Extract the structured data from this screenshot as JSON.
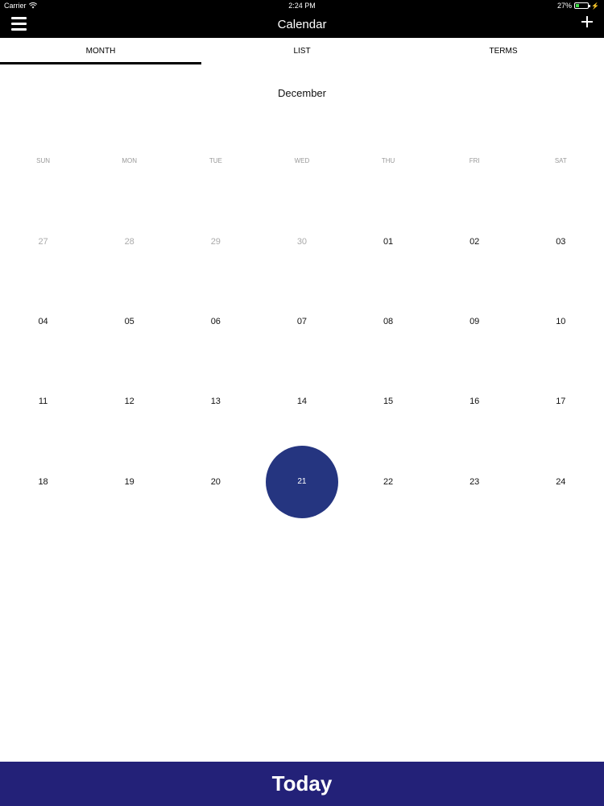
{
  "status_bar": {
    "carrier": "Carrier",
    "time": "2:24 PM",
    "battery": "27%",
    "battery_level": 0.27,
    "icons": [
      "wifi-icon",
      "battery-icon",
      "charge-icon"
    ]
  },
  "nav": {
    "title": "Calendar",
    "menu_icon": "menu-icon",
    "add_icon": "add-icon"
  },
  "tabs": [
    {
      "label": "MONTH",
      "active": true
    },
    {
      "label": "LIST",
      "active": false
    },
    {
      "label": "TERMS",
      "active": false
    }
  ],
  "month": "December",
  "weekdays": [
    "SUN",
    "MON",
    "TUE",
    "WED",
    "THU",
    "FRI",
    "SAT"
  ],
  "weeks": [
    [
      {
        "d": "27",
        "other": true
      },
      {
        "d": "28",
        "other": true
      },
      {
        "d": "29",
        "other": true
      },
      {
        "d": "30",
        "other": true
      },
      {
        "d": "01"
      },
      {
        "d": "02"
      },
      {
        "d": "03"
      }
    ],
    [
      {
        "d": "04"
      },
      {
        "d": "05"
      },
      {
        "d": "06"
      },
      {
        "d": "07"
      },
      {
        "d": "08"
      },
      {
        "d": "09"
      },
      {
        "d": "10"
      }
    ],
    [
      {
        "d": "11"
      },
      {
        "d": "12"
      },
      {
        "d": "13"
      },
      {
        "d": "14"
      },
      {
        "d": "15"
      },
      {
        "d": "16"
      },
      {
        "d": "17"
      }
    ],
    [
      {
        "d": "18"
      },
      {
        "d": "19"
      },
      {
        "d": "20"
      },
      {
        "d": "21",
        "selected": true
      },
      {
        "d": "22"
      },
      {
        "d": "23"
      },
      {
        "d": "24"
      }
    ]
  ],
  "today_button": "Today",
  "colors": {
    "header_bg": "#000000",
    "selected_circle": "#253580",
    "today_bar_bg": "#232178",
    "battery_fill": "#3ddc47"
  }
}
